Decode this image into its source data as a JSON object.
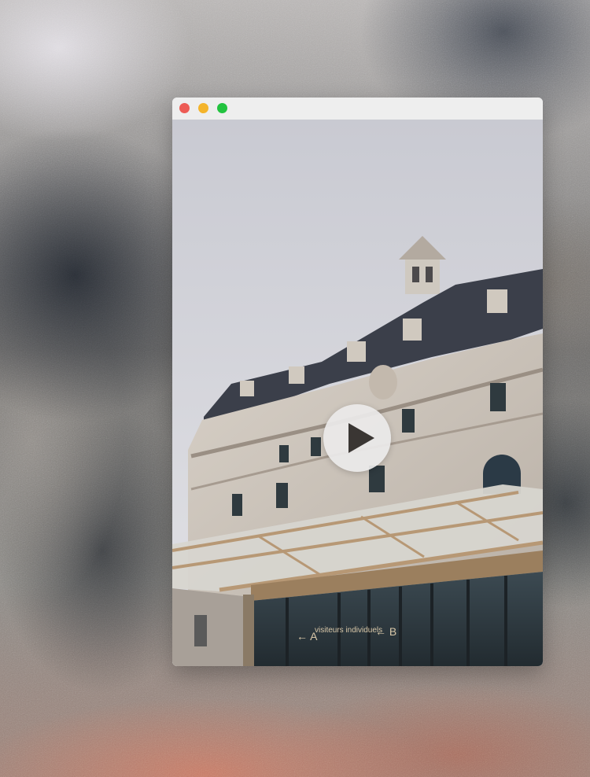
{
  "window": {
    "title": "",
    "controls": [
      {
        "name": "close",
        "color": "#ed5b55"
      },
      {
        "name": "minimize",
        "color": "#f4b42b"
      },
      {
        "name": "zoom",
        "color": "#22c33f"
      }
    ]
  },
  "player": {
    "icon": "play-icon",
    "accent": "#3a3633"
  },
  "scene": {
    "sign_text": "visiteurs individuels",
    "door_letters": [
      "A",
      "B"
    ]
  }
}
